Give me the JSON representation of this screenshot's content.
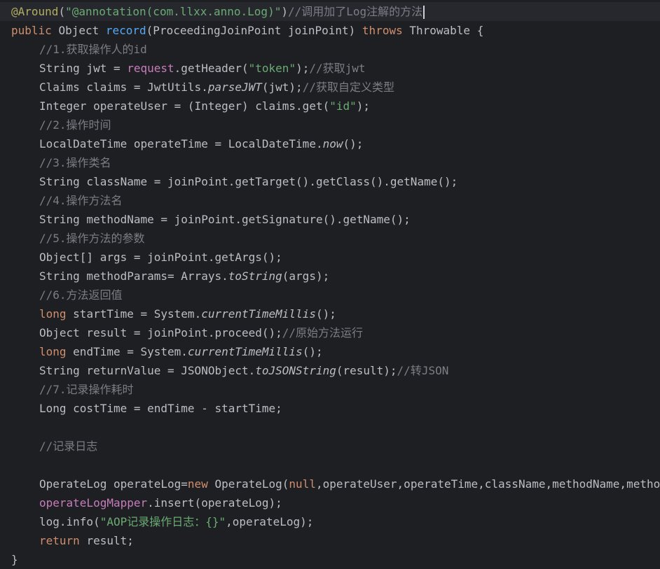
{
  "editor": {
    "colors": {
      "background": "#1e1f22",
      "keyword": "#cf8e6d",
      "annotation": "#b3ae60",
      "string": "#6aab73",
      "comment": "#7a7e85",
      "field": "#c77dbb",
      "method_declaration": "#56a8f5",
      "plain": "#bcbec4"
    },
    "lines": [
      {
        "indent": 0,
        "tokens": [
          {
            "t": "ann",
            "v": "@Around"
          },
          {
            "t": "plain",
            "v": "("
          },
          {
            "t": "str",
            "v": "\"@annotation(com.llxx.anno.Log)\""
          },
          {
            "t": "plain",
            "v": ")"
          },
          {
            "t": "cmt",
            "v": "//调用加了Log注解的方法"
          }
        ],
        "caret": true
      },
      {
        "indent": 0,
        "tokens": [
          {
            "t": "kw",
            "v": "public "
          },
          {
            "t": "plain",
            "v": "Object "
          },
          {
            "t": "fn",
            "v": "record"
          },
          {
            "t": "plain",
            "v": "(ProceedingJoinPoint joinPoint) "
          },
          {
            "t": "kw",
            "v": "throws "
          },
          {
            "t": "plain",
            "v": "Throwable {"
          }
        ]
      },
      {
        "indent": 1,
        "tokens": [
          {
            "t": "cmt",
            "v": "//1.获取操作人的id"
          }
        ]
      },
      {
        "indent": 1,
        "tokens": [
          {
            "t": "plain",
            "v": "String jwt = "
          },
          {
            "t": "field",
            "v": "request"
          },
          {
            "t": "plain",
            "v": ".getHeader("
          },
          {
            "t": "str",
            "v": "\"token\""
          },
          {
            "t": "plain",
            "v": ");"
          },
          {
            "t": "cmt",
            "v": "//获取jwt"
          }
        ]
      },
      {
        "indent": 1,
        "tokens": [
          {
            "t": "plain",
            "v": "Claims claims = JwtUtils."
          },
          {
            "t": "static",
            "v": "parseJWT"
          },
          {
            "t": "plain",
            "v": "(jwt);"
          },
          {
            "t": "cmt",
            "v": "//获取自定义类型"
          }
        ]
      },
      {
        "indent": 1,
        "tokens": [
          {
            "t": "plain",
            "v": "Integer operateUser = (Integer) claims.get("
          },
          {
            "t": "str",
            "v": "\"id\""
          },
          {
            "t": "plain",
            "v": ");"
          }
        ]
      },
      {
        "indent": 1,
        "tokens": [
          {
            "t": "cmt",
            "v": "//2.操作时间"
          }
        ]
      },
      {
        "indent": 1,
        "tokens": [
          {
            "t": "plain",
            "v": "LocalDateTime operateTime = LocalDateTime."
          },
          {
            "t": "static",
            "v": "now"
          },
          {
            "t": "plain",
            "v": "();"
          }
        ]
      },
      {
        "indent": 1,
        "tokens": [
          {
            "t": "cmt",
            "v": "//3.操作类名"
          }
        ]
      },
      {
        "indent": 1,
        "tokens": [
          {
            "t": "plain",
            "v": "String className = joinPoint.getTarget().getClass().getName();"
          }
        ]
      },
      {
        "indent": 1,
        "tokens": [
          {
            "t": "cmt",
            "v": "//4.操作方法名"
          }
        ]
      },
      {
        "indent": 1,
        "tokens": [
          {
            "t": "plain",
            "v": "String methodName = joinPoint.getSignature().getName();"
          }
        ]
      },
      {
        "indent": 1,
        "tokens": [
          {
            "t": "cmt",
            "v": "//5.操作方法的参数"
          }
        ]
      },
      {
        "indent": 1,
        "tokens": [
          {
            "t": "plain",
            "v": "Object[] args = joinPoint.getArgs();"
          }
        ]
      },
      {
        "indent": 1,
        "tokens": [
          {
            "t": "plain",
            "v": "String methodParams= Arrays."
          },
          {
            "t": "static",
            "v": "toString"
          },
          {
            "t": "plain",
            "v": "(args);"
          }
        ]
      },
      {
        "indent": 1,
        "tokens": [
          {
            "t": "cmt",
            "v": "//6.方法返回值"
          }
        ]
      },
      {
        "indent": 1,
        "tokens": [
          {
            "t": "kw",
            "v": "long "
          },
          {
            "t": "plain",
            "v": "startTime = System."
          },
          {
            "t": "static",
            "v": "currentTimeMillis"
          },
          {
            "t": "plain",
            "v": "();"
          }
        ]
      },
      {
        "indent": 1,
        "tokens": [
          {
            "t": "plain",
            "v": "Object result = joinPoint.proceed();"
          },
          {
            "t": "cmt",
            "v": "//原始方法运行"
          }
        ]
      },
      {
        "indent": 1,
        "tokens": [
          {
            "t": "kw",
            "v": "long "
          },
          {
            "t": "plain",
            "v": "endTime = System."
          },
          {
            "t": "static",
            "v": "currentTimeMillis"
          },
          {
            "t": "plain",
            "v": "();"
          }
        ]
      },
      {
        "indent": 1,
        "tokens": [
          {
            "t": "plain",
            "v": "String returnValue = JSONObject."
          },
          {
            "t": "static",
            "v": "toJSONString"
          },
          {
            "t": "plain",
            "v": "(result);"
          },
          {
            "t": "cmt",
            "v": "//转JSON"
          }
        ]
      },
      {
        "indent": 1,
        "tokens": [
          {
            "t": "cmt",
            "v": "//7.记录操作耗时"
          }
        ]
      },
      {
        "indent": 1,
        "tokens": [
          {
            "t": "plain",
            "v": "Long costTime = endTime - startTime;"
          }
        ]
      },
      {
        "indent": 0,
        "tokens": []
      },
      {
        "indent": 1,
        "tokens": [
          {
            "t": "cmt",
            "v": "//记录日志"
          }
        ]
      },
      {
        "indent": 0,
        "tokens": []
      },
      {
        "indent": 1,
        "tokens": [
          {
            "t": "plain",
            "v": "OperateLog operateLog="
          },
          {
            "t": "kw",
            "v": "new "
          },
          {
            "t": "plain",
            "v": "OperateLog("
          },
          {
            "t": "kw",
            "v": "null"
          },
          {
            "t": "plain",
            "v": ",operateUser,operateTime,className,methodName,methodParams,returnValue,costTime);"
          }
        ]
      },
      {
        "indent": 1,
        "tokens": [
          {
            "t": "field",
            "v": "operateLogMapper"
          },
          {
            "t": "plain",
            "v": ".insert(operateLog);"
          }
        ]
      },
      {
        "indent": 1,
        "tokens": [
          {
            "t": "plain",
            "v": "log.info("
          },
          {
            "t": "str",
            "v": "\"AOP记录操作日志：{}\""
          },
          {
            "t": "plain",
            "v": ",operateLog);"
          }
        ]
      },
      {
        "indent": 1,
        "tokens": [
          {
            "t": "kw",
            "v": "return "
          },
          {
            "t": "plain",
            "v": "result;"
          }
        ]
      },
      {
        "indent": 0,
        "tokens": [
          {
            "t": "plain",
            "v": "}"
          }
        ]
      }
    ]
  }
}
